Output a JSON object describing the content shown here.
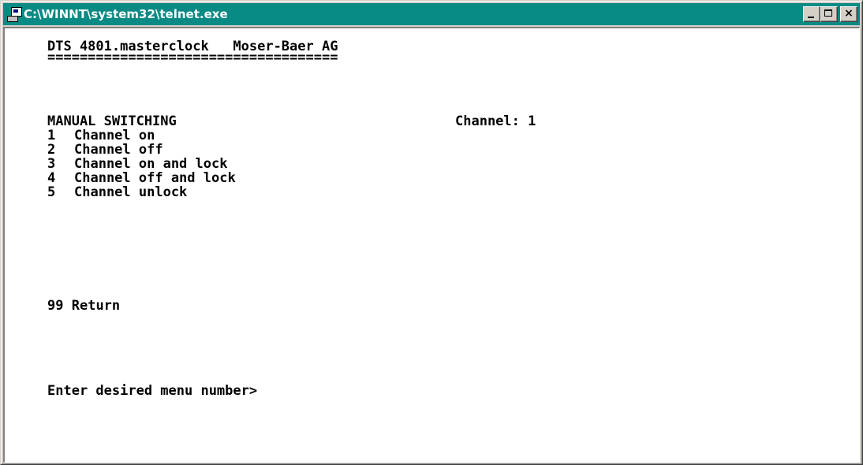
{
  "window": {
    "title": "C:\\WINNT\\system32\\telnet.exe",
    "buttons": {
      "minimize": "minimize",
      "maximize": "maximize",
      "close": "×"
    }
  },
  "terminal": {
    "header": "DTS 4801.masterclock   Moser-Baer AG",
    "separator": "====================================",
    "section_title": "MANUAL SWITCHING",
    "channel_status": "Channel: 1",
    "menu_items": [
      {
        "number": "1",
        "label": "Channel on"
      },
      {
        "number": "2",
        "label": "Channel off"
      },
      {
        "number": "3",
        "label": "Channel on and lock"
      },
      {
        "number": "4",
        "label": "Channel off and lock"
      },
      {
        "number": "5",
        "label": "Channel unlock"
      }
    ],
    "return_item": {
      "number": "99",
      "label": "Return"
    },
    "prompt": "Enter desired menu number>"
  }
}
